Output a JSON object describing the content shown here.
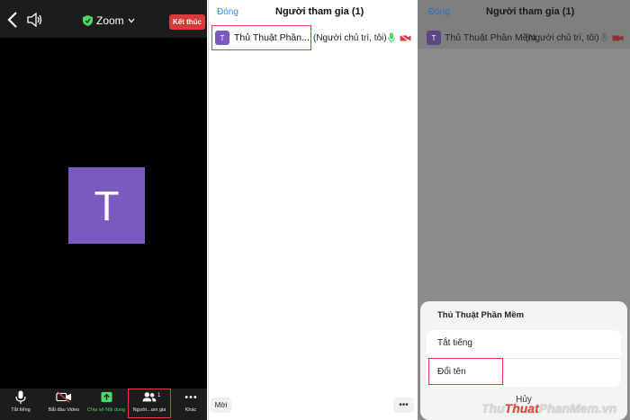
{
  "meeting": {
    "app_title": "Zoom",
    "end_label": "Kết thúc",
    "avatar_letter": "T",
    "toolbar": {
      "mute_label": "Tắt tiếng",
      "video_label": "Bắt đầu Video",
      "share_label": "Chia sẻ Nội dung",
      "participants_label": "Người...am gia",
      "participants_count": "1",
      "more_label": "Khác"
    }
  },
  "participants": {
    "close_label": "Đóng",
    "title": "Người tham gia (1)",
    "row": {
      "avatar_letter": "T",
      "name": "Thủ Thuật Phần...",
      "role": "(Người chủ trì, tôi)"
    },
    "invite_label": "Mời",
    "more_label": "•••"
  },
  "action_sheet": {
    "close_label": "Đóng",
    "header_title": "Người tham gia (1)",
    "row": {
      "avatar_letter": "T",
      "name": "Thủ Thuật Phần Mềm",
      "role": "(Người chủ trì, tôi)"
    },
    "sheet_title": "Thủ Thuật Phần Mềm",
    "options": [
      "Tắt tiếng",
      "Đổi tên"
    ],
    "cancel_label": "Hủy"
  },
  "watermark": {
    "part1": "Thu",
    "part2": "Thuat",
    "part3": "PhanMem",
    "suffix": ".vn"
  },
  "colors": {
    "accent_blue": "#2d8cff",
    "avatar_purple": "#7a59c1",
    "end_red": "#d93a3a",
    "highlight_red": "#e03b3b"
  }
}
